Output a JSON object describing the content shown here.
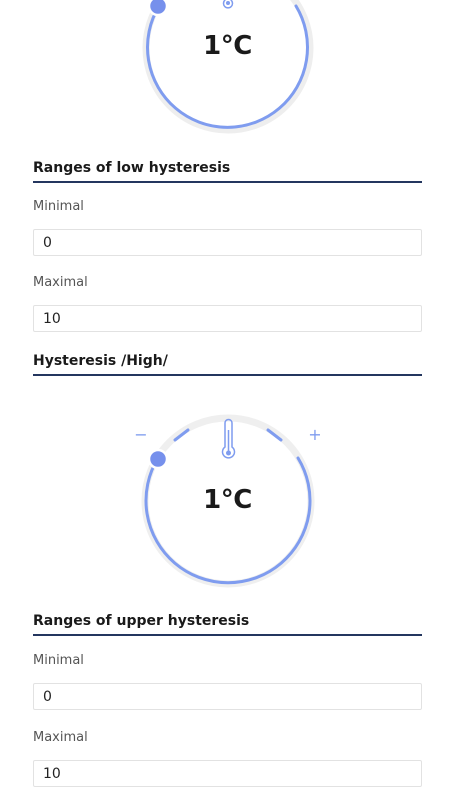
{
  "low_dial": {
    "value_text": "1°C",
    "minus_label": "−",
    "plus_label": "+"
  },
  "low_ranges": {
    "title": "Ranges of low hysteresis",
    "minimal_label": "Minimal",
    "minimal_value": "0",
    "maximal_label": "Maximal",
    "maximal_value": "10"
  },
  "high_section": {
    "title": "Hysteresis /High/"
  },
  "high_dial": {
    "value_text": "1°C",
    "minus_label": "−",
    "plus_label": "+"
  },
  "upper_ranges": {
    "title": "Ranges of upper hysteresis",
    "minimal_label": "Minimal",
    "minimal_value": "0",
    "maximal_label": "Maximal",
    "maximal_value": "10"
  },
  "icons": {
    "thermometer": "thermometer-icon",
    "handle": "dial-handle"
  },
  "colors": {
    "dial_arc": "#7f9cef",
    "dial_handle": "#7690ec",
    "track_shadow": "#eeeeee",
    "section_rule": "#24365f"
  }
}
